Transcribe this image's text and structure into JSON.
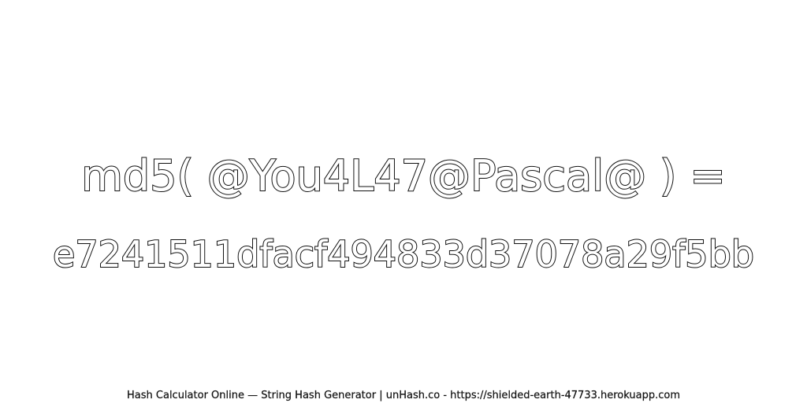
{
  "expression": "md5( @You4L47@Pascal@ ) =",
  "hash": "e7241511dfacf494833d37078a29f5bb",
  "footer": "Hash Calculator Online — String Hash Generator | unHash.co - https://shielded-earth-47733.herokuapp.com"
}
